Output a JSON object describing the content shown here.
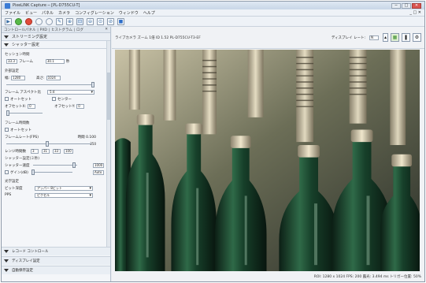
{
  "window": {
    "title": "PixeLINK Capture ─ [PL-D755CU-T]",
    "controls": {
      "minimize": "─",
      "maximize": "□",
      "close": "✕"
    }
  },
  "menubar": {
    "items": [
      "ファイル",
      "ビュー",
      "パネル",
      "カメラ",
      "コンフィグレーション",
      "ウィンドウ",
      "ヘルプ"
    ],
    "right": "_ □ ✕"
  },
  "sidebar": {
    "tabs_text": "コントロールパネル  ∣  PXD  ∣  ヒストグラム  ∣  ログ",
    "panel_title": "ストリーミング設定",
    "section_title": "シャッター設定",
    "exposure_label": "セッション時間",
    "exposure_value": "33.3",
    "frame_label": "フレーム",
    "frame_value": "30.1",
    "frame_unit": "秒",
    "size_label": "外部設定",
    "width_label": "幅:",
    "width_value": "1280",
    "height_label": "高さ:",
    "height_value": "1024",
    "frame_aspect_label": "フレーム アスペクト比",
    "frame_aspect_value": "5:4",
    "autoset_label": "オートセット",
    "center_label": "センター",
    "offset_x_label": "オフセットX:",
    "offset_x_value": "0",
    "offset_y_label": "オフセットY:",
    "offset_y_value": "0",
    "frame_control_label": "フレーム時間数",
    "auto_label": "オートセット",
    "frame_rate_label": "フレームレート(FPS)",
    "frame_rate_hint": "時間 0.100",
    "frame_rate_max": "250",
    "scan_label": "レンジ時間数",
    "scan_values": [
      "3",
      "31",
      "33",
      "100"
    ],
    "shutter_label": "シャッター設定(ミ秒)",
    "shutter_hint": "シャッター速度",
    "shutter_value": "1000",
    "gain_label": "ゲイン(dB)",
    "gain_value": "Auto",
    "optics_label": "光学設定",
    "bit_label": "ビット深度",
    "bit_value": "アッパー 8ビット",
    "pixel_label": "PPS",
    "pixel_value": "ピクセル",
    "footer": [
      "レコード コントロール",
      "ディスプレイ設定",
      "自動保存設定"
    ]
  },
  "main": {
    "camera_line": "ライブカメラ  ズーム 1倍  ID 1.52  PL-D755CU-T3-EF",
    "display_label": "ディスプレイ レート:",
    "display_value": "N",
    "status": "ROI: 1280 x 1024   FPS: 200   露光: 3.494 ms   トリガー位置: 50%"
  },
  "colors": {
    "accent": "#3a7bd5",
    "window_bg": "#e7ebf0",
    "viewport_bg": "#1a1d1c",
    "bottle_glass": "#1f4a33",
    "cap_metal": "#d7c6a0"
  }
}
